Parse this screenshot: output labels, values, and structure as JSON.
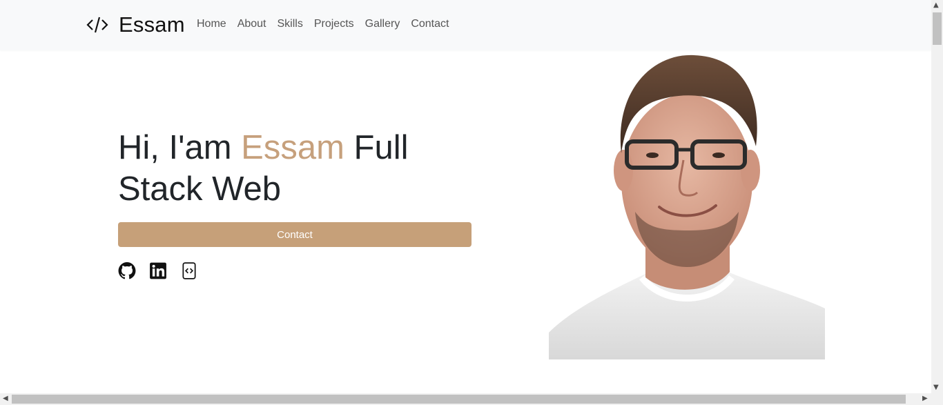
{
  "navbar": {
    "brand_icon": "code-brackets-icon",
    "brand_name": "Essam",
    "links": [
      "Home",
      "About",
      "Skills",
      "Projects",
      "Gallery",
      "Contact"
    ]
  },
  "hero": {
    "title_prefix": "Hi, I'am ",
    "title_name": "Essam",
    "title_suffix": " Full Stack Web",
    "contact_button": "Contact",
    "socials": [
      "github-icon",
      "linkedin-icon",
      "code-file-icon"
    ],
    "portrait": "portrait-photo"
  },
  "colors": {
    "accent": "#c6a07c",
    "navbar_bg": "#f8f9fa",
    "button_bg": "#c6a079"
  }
}
